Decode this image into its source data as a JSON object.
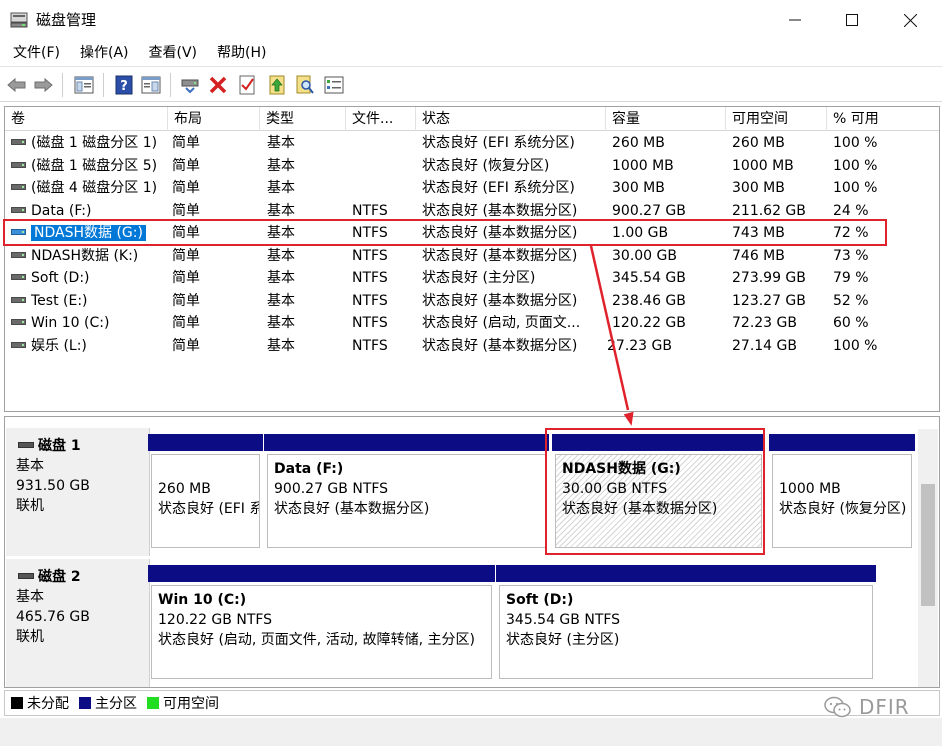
{
  "window": {
    "title": "磁盘管理",
    "minimize": "—",
    "maximize": "☐",
    "close": "✕"
  },
  "menu": [
    "文件(F)",
    "操作(A)",
    "查看(V)",
    "帮助(H)"
  ],
  "toolbar": {
    "icons": [
      "back-arrow-icon",
      "forward-arrow-icon",
      "console-tree-icon",
      "help-icon",
      "properties-pane-icon",
      "connect-drive-icon",
      "delete-icon",
      "checklist-icon",
      "up-icon",
      "search-icon",
      "options-icon"
    ]
  },
  "volume_table": {
    "columns": [
      "卷",
      "布局",
      "类型",
      "文件...",
      "状态",
      "容量",
      "可用空间",
      "% 可用"
    ],
    "rows": [
      [
        "(磁盘 1 磁盘分区 1)",
        "简单",
        "基本",
        "",
        "状态良好 (EFI 系统分区)",
        "260 MB",
        "260 MB",
        "100 %"
      ],
      [
        "(磁盘 1 磁盘分区 5)",
        "简单",
        "基本",
        "",
        "状态良好 (恢复分区)",
        "1000 MB",
        "1000 MB",
        "100 %"
      ],
      [
        "(磁盘 4 磁盘分区 1)",
        "简单",
        "基本",
        "",
        "状态良好 (EFI 系统分区)",
        "300 MB",
        "300 MB",
        "100 %"
      ],
      [
        "Data (F:)",
        "简单",
        "基本",
        "NTFS",
        "状态良好 (基本数据分区)",
        "900.27 GB",
        "211.62 GB",
        "24 %"
      ],
      [
        "NDASH数据 (G:)",
        "简单",
        "基本",
        "NTFS",
        "状态良好 (基本数据分区)",
        "1.00 GB",
        "743 MB",
        "72 %"
      ],
      [
        "NDASH数据 (K:)",
        "简单",
        "基本",
        "NTFS",
        "状态良好 (基本数据分区)",
        "30.00 GB",
        "746 MB",
        "73 %"
      ],
      [
        "Soft (D:)",
        "简单",
        "基本",
        "NTFS",
        "状态良好 (主分区)",
        "345.54 GB",
        "273.99 GB",
        "79 %"
      ],
      [
        "Test (E:)",
        "简单",
        "基本",
        "NTFS",
        "状态良好 (基本数据分区)",
        "238.46 GB",
        "123.27 GB",
        "52 %"
      ],
      [
        "Win 10 (C:)",
        "简单",
        "基本",
        "NTFS",
        "状态良好 (启动, 页面文...",
        "120.22 GB",
        "72.23 GB",
        "60 %"
      ],
      [
        "娱乐 (L:)",
        "简单",
        "基本",
        "NTFS",
        "状态良好 (基本数据分区)",
        "27.23 GB",
        "27.14 GB",
        "100 %"
      ]
    ]
  },
  "disks": [
    {
      "name": "磁盘 1",
      "type": "基本",
      "size": "931.50 GB",
      "status": "联机",
      "partitions": [
        {
          "title": "",
          "size": "260 MB",
          "status": "状态良好 (EFI 系统分区)"
        },
        {
          "title": "Data  (F:)",
          "size": "900.27 GB NTFS",
          "status": "状态良好 (基本数据分区)"
        },
        {
          "title": "NDASH数据  (G:)",
          "size": "30.00 GB NTFS",
          "status": "状态良好 (基本数据分区)"
        },
        {
          "title": "",
          "size": "1000 MB",
          "status": "状态良好 (恢复分区)"
        }
      ]
    },
    {
      "name": "磁盘 2",
      "type": "基本",
      "size": "465.76 GB",
      "status": "联机",
      "partitions": [
        {
          "title": "Win 10  (C:)",
          "size": "120.22 GB NTFS",
          "status": "状态良好 (启动, 页面文件, 活动, 故障转储, 主分区)"
        },
        {
          "title": "Soft  (D:)",
          "size": "345.54 GB NTFS",
          "status": "状态良好 (主分区)"
        }
      ]
    }
  ],
  "legend": [
    {
      "label": "未分配",
      "color": "#000000"
    },
    {
      "label": "主分区",
      "color": "#0c0c84"
    },
    {
      "label": "可用空间",
      "color": "#22dd22"
    }
  ],
  "watermark": "DFIR",
  "colors": {
    "selection": "#0078d7",
    "annotation_red": "#e0222c",
    "partition_bar": "#0c0c84"
  }
}
